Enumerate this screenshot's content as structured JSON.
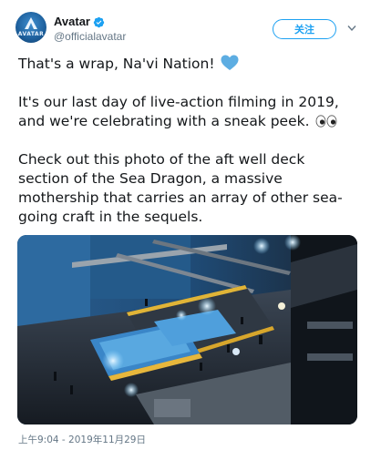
{
  "user": {
    "display_name": "Avatar",
    "handle": "@officialavatar",
    "avatar_logo_text": "AVATAR",
    "verified": true
  },
  "follow_button": {
    "label": "关注"
  },
  "menu": {
    "icon": "chevron-down-icon"
  },
  "tweet": {
    "paragraph1": "That's a wrap, Na'vi Nation!",
    "paragraph2": [
      "It's our last day of live-action filming in 2019,",
      "and we're celebrating with a sneak peek."
    ],
    "paragraph3": [
      "Check out this photo of the aft well deck",
      "section of the Sea Dragon, a massive",
      "mothership that carries an array of other sea-",
      "going craft in the sequels."
    ],
    "emoji": [
      "blue-heart",
      "eyes"
    ]
  },
  "timestamp": "上午9:04 - 2019年11月29日",
  "colors": {
    "accent": "#1da1f2",
    "heart": "#5dade2",
    "secondary_text": "#657786"
  }
}
